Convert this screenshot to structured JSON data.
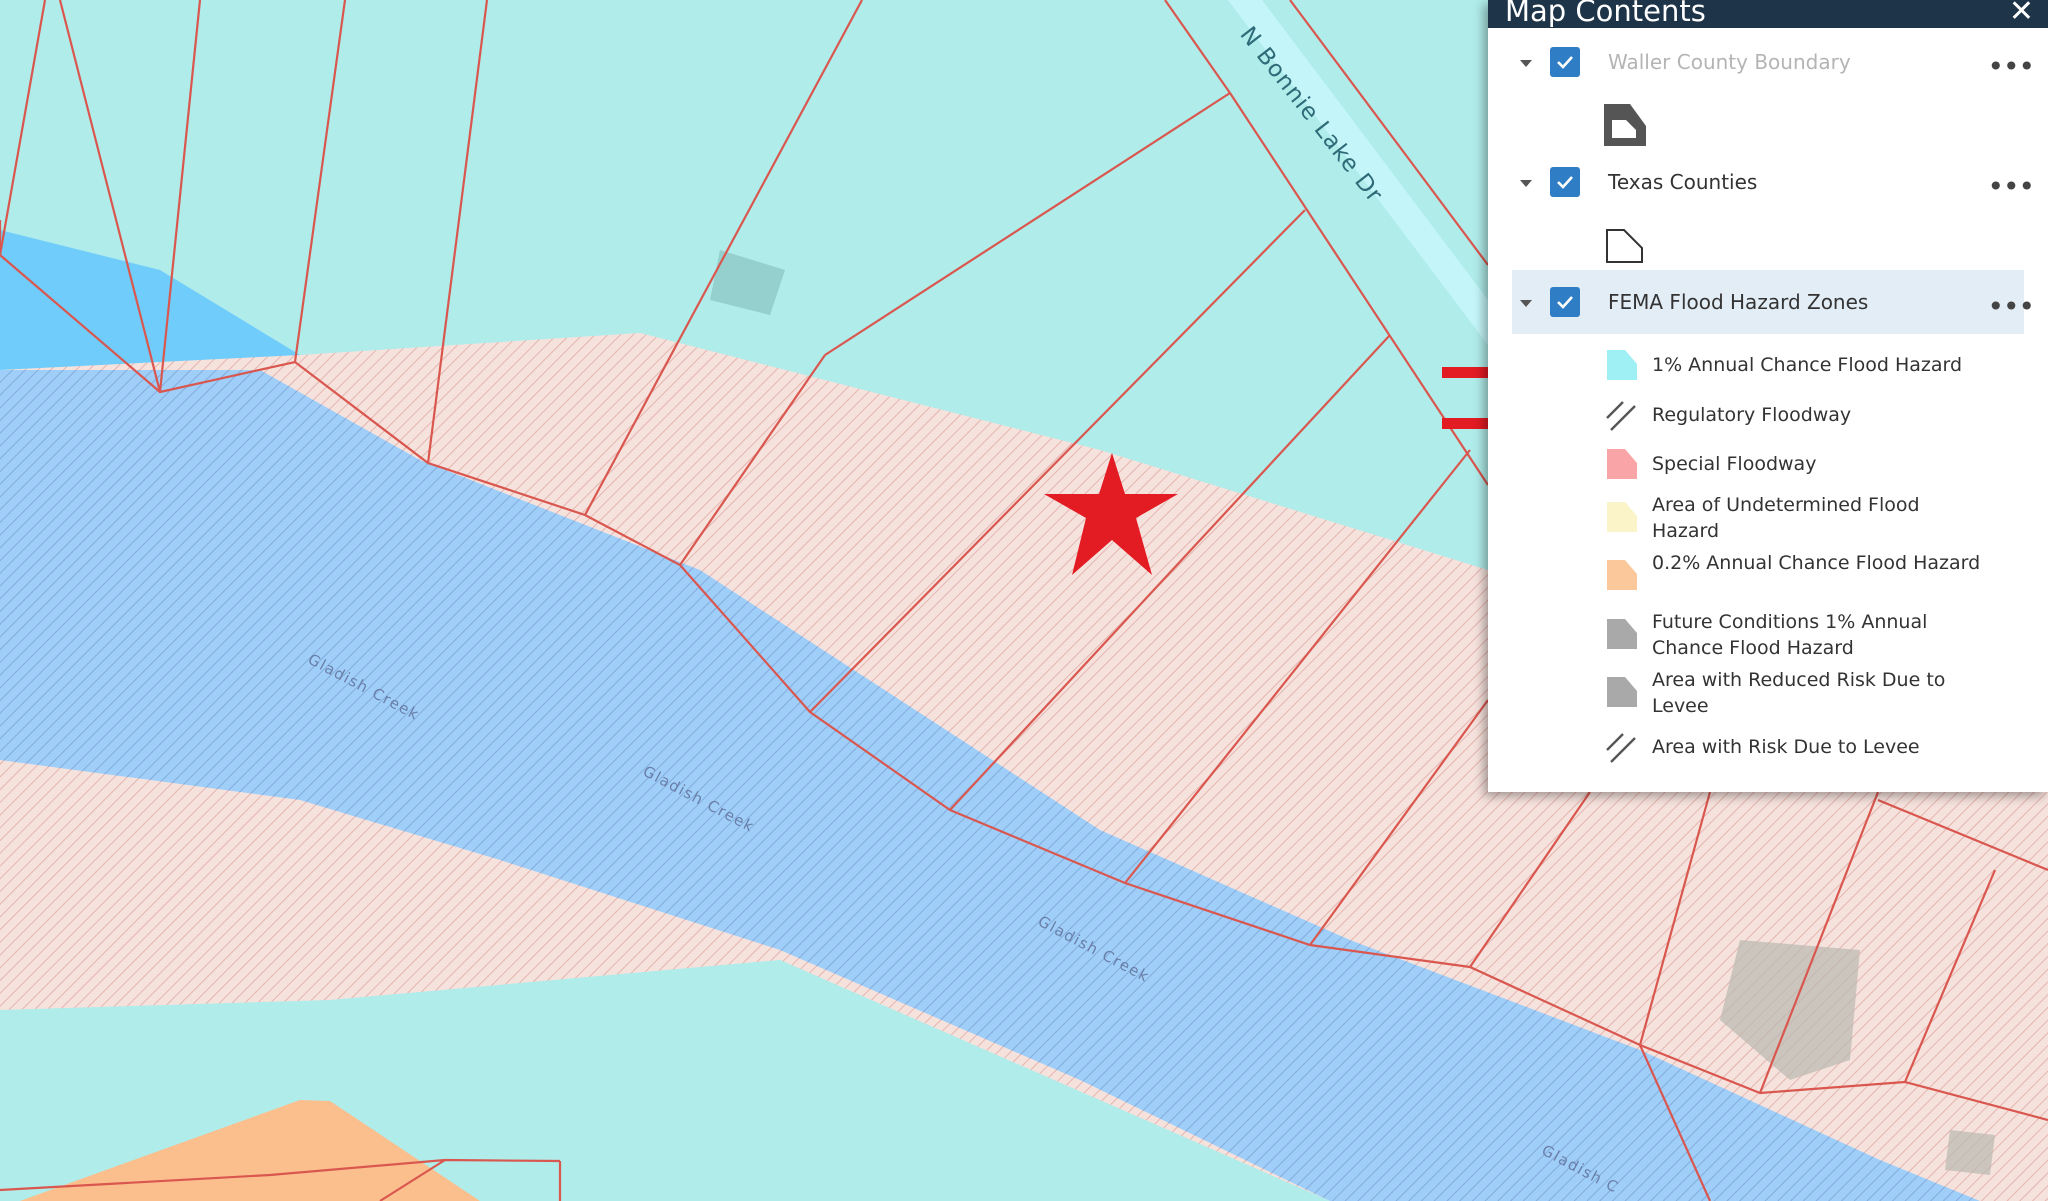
{
  "map": {
    "road_label": "N Bonnie Lake Dr",
    "creek_labels": [
      "Gladish Creek",
      "Gladish Creek",
      "Gladish Creek",
      "Gladish C"
    ],
    "colors": {
      "flood_1pct": "#b0ecea",
      "floodway_pink": "#f6e2dd",
      "floodway_blue": "#9fcef8",
      "creek_blue": "#70cdfb",
      "parcel_line": "#d9574f",
      "orange_zone": "#fbbf8d",
      "marker_red": "#e31b23"
    },
    "marker_icon": "star-marker"
  },
  "panel": {
    "title": "Map Contents",
    "close_icon": "close-icon",
    "layers": [
      {
        "name": "Waller County Boundary",
        "checked": true,
        "dimmed": true
      },
      {
        "name": "Texas Counties",
        "checked": true,
        "dimmed": false
      },
      {
        "name": "FEMA Flood Hazard Zones",
        "checked": true,
        "dimmed": false,
        "selected": true
      }
    ],
    "more_label": "•••",
    "legend": [
      {
        "label": "1% Annual Chance Flood Hazard",
        "swatch": "cyan"
      },
      {
        "label": "Regulatory Floodway",
        "swatch": "hatch"
      },
      {
        "label": "Special Floodway",
        "swatch": "pink"
      },
      {
        "label": "Area of Undetermined Flood Hazard",
        "swatch": "yellow"
      },
      {
        "label": "0.2% Annual Chance Flood Hazard",
        "swatch": "orange"
      },
      {
        "label": "Future Conditions 1% Annual Chance Flood Hazard",
        "swatch": "gray"
      },
      {
        "label": "Area with Reduced Risk Due to Levee",
        "swatch": "gray"
      },
      {
        "label": "Area with Risk Due to Levee",
        "swatch": "hatch"
      }
    ]
  }
}
